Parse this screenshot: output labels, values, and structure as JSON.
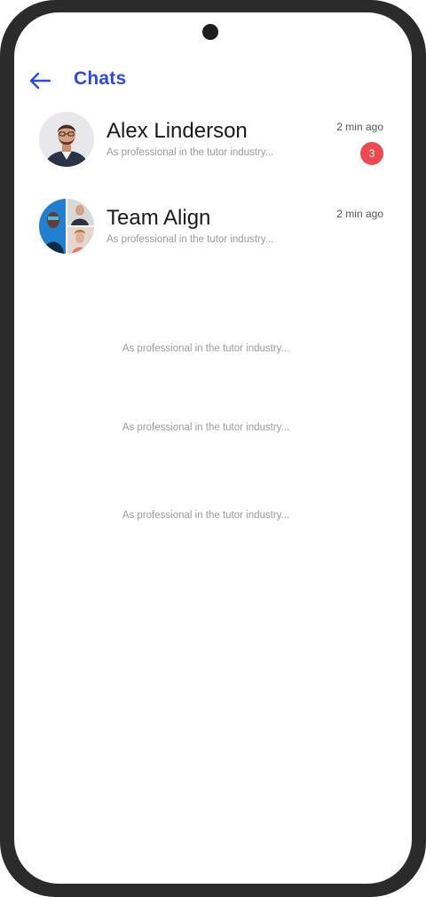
{
  "header": {
    "title": "Chats",
    "back_icon": "arrow-left-icon",
    "accent_color": "#2f49e6"
  },
  "chats": [
    {
      "name": "Alex Linderson",
      "preview": "As professional in the tutor industry...",
      "time": "2 min ago",
      "unread": "3",
      "avatar": "person-avatar"
    },
    {
      "name": "Team Align",
      "preview": "As professional in the tutor industry...",
      "time": "2 min ago",
      "avatar": "group-avatar"
    }
  ],
  "ghost_previews": [
    "As professional in the tutor industry...",
    "As professional in the tutor industry...",
    "As professional in the tutor industry..."
  ],
  "colors": {
    "badge": "#ec4a4f",
    "frame": "#2b2b2b"
  }
}
